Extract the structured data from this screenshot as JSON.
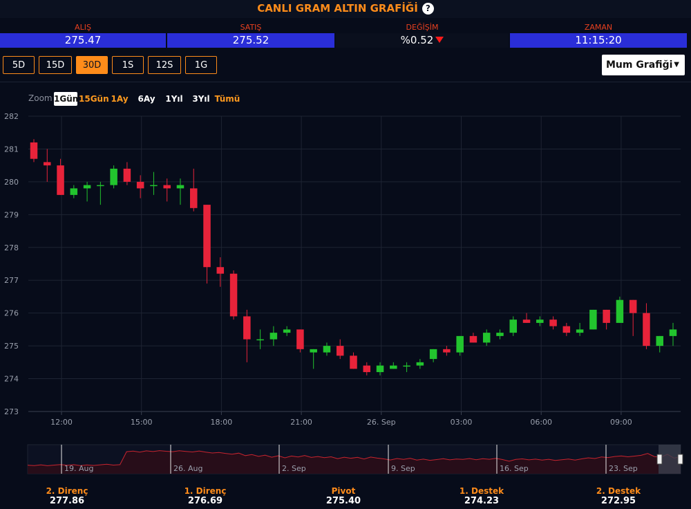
{
  "header": {
    "title": "CANLI GRAM ALTIN GRAFİĞİ",
    "help_icon": "?"
  },
  "stats": {
    "alis": {
      "label": "ALIŞ",
      "value": "275.47"
    },
    "satis": {
      "label": "SATIŞ",
      "value": "275.52"
    },
    "degisim": {
      "label": "DEĞİŞİM",
      "value": "%0.52",
      "direction": "down",
      "color": "#ff1a1a"
    },
    "zaman": {
      "label": "ZAMAN",
      "value": "11:15:20"
    }
  },
  "periods": [
    "5D",
    "15D",
    "30D",
    "1S",
    "12S",
    "1G"
  ],
  "active_period": "30D",
  "chart_type_select": {
    "value": "Mum Grafiği"
  },
  "zoom": {
    "label": "Zoom",
    "options": [
      "1Gün",
      "15Gün",
      "1Ay",
      "6Ay",
      "1Yıl",
      "3Yıl",
      "Tümü"
    ],
    "active": "1Gün"
  },
  "colors": {
    "accent": "#ff8c1a",
    "up": "#22c42e",
    "down": "#e8233a",
    "blue_bar": "#2a2ed8",
    "background": "#070c1a"
  },
  "chart_data": {
    "type": "candlestick",
    "title": "",
    "xlabel": "",
    "ylabel": "",
    "ylim": [
      273,
      282
    ],
    "y_ticks": [
      "282",
      "281",
      "280",
      "279",
      "278",
      "277",
      "276",
      "275",
      "274",
      "273"
    ],
    "x_ticks": [
      "12:00",
      "15:00",
      "18:00",
      "21:00",
      "26. Sep",
      "03:00",
      "06:00",
      "09:00"
    ],
    "grid": true,
    "candles": [
      {
        "o": 281.2,
        "h": 281.3,
        "l": 280.6,
        "c": 280.7
      },
      {
        "o": 280.6,
        "h": 281.0,
        "l": 280.0,
        "c": 280.5
      },
      {
        "o": 280.5,
        "h": 280.7,
        "l": 279.6,
        "c": 279.6
      },
      {
        "o": 279.6,
        "h": 279.9,
        "l": 279.5,
        "c": 279.8
      },
      {
        "o": 279.8,
        "h": 280.0,
        "l": 279.4,
        "c": 279.9
      },
      {
        "o": 279.9,
        "h": 280.0,
        "l": 279.3,
        "c": 279.9
      },
      {
        "o": 279.9,
        "h": 280.5,
        "l": 279.8,
        "c": 280.4
      },
      {
        "o": 280.4,
        "h": 280.6,
        "l": 279.9,
        "c": 280.0
      },
      {
        "o": 280.0,
        "h": 280.2,
        "l": 279.5,
        "c": 279.8
      },
      {
        "o": 279.9,
        "h": 280.3,
        "l": 279.6,
        "c": 279.9
      },
      {
        "o": 279.9,
        "h": 280.1,
        "l": 279.4,
        "c": 279.8
      },
      {
        "o": 279.8,
        "h": 280.1,
        "l": 279.3,
        "c": 279.9
      },
      {
        "o": 279.8,
        "h": 280.4,
        "l": 279.1,
        "c": 279.2
      },
      {
        "o": 279.3,
        "h": 279.3,
        "l": 276.9,
        "c": 277.4
      },
      {
        "o": 277.4,
        "h": 277.7,
        "l": 276.8,
        "c": 277.2
      },
      {
        "o": 277.2,
        "h": 277.3,
        "l": 275.8,
        "c": 275.9
      },
      {
        "o": 275.9,
        "h": 276.1,
        "l": 274.5,
        "c": 275.2
      },
      {
        "o": 275.2,
        "h": 275.5,
        "l": 274.9,
        "c": 275.2
      },
      {
        "o": 275.2,
        "h": 275.6,
        "l": 275.0,
        "c": 275.4
      },
      {
        "o": 275.4,
        "h": 275.6,
        "l": 275.3,
        "c": 275.5
      },
      {
        "o": 275.5,
        "h": 275.5,
        "l": 274.8,
        "c": 274.9
      },
      {
        "o": 274.8,
        "h": 274.9,
        "l": 274.3,
        "c": 274.9
      },
      {
        "o": 274.8,
        "h": 275.1,
        "l": 274.7,
        "c": 275.0
      },
      {
        "o": 275.0,
        "h": 275.2,
        "l": 274.6,
        "c": 274.7
      },
      {
        "o": 274.7,
        "h": 274.8,
        "l": 274.3,
        "c": 274.3
      },
      {
        "o": 274.4,
        "h": 274.5,
        "l": 274.1,
        "c": 274.2
      },
      {
        "o": 274.2,
        "h": 274.5,
        "l": 274.1,
        "c": 274.4
      },
      {
        "o": 274.3,
        "h": 274.5,
        "l": 274.3,
        "c": 274.4
      },
      {
        "o": 274.4,
        "h": 274.5,
        "l": 274.2,
        "c": 274.4
      },
      {
        "o": 274.4,
        "h": 274.6,
        "l": 274.3,
        "c": 274.5
      },
      {
        "o": 274.6,
        "h": 274.9,
        "l": 274.5,
        "c": 274.9
      },
      {
        "o": 274.9,
        "h": 275.0,
        "l": 274.7,
        "c": 274.8
      },
      {
        "o": 274.8,
        "h": 275.3,
        "l": 274.7,
        "c": 275.3
      },
      {
        "o": 275.3,
        "h": 275.4,
        "l": 275.1,
        "c": 275.1
      },
      {
        "o": 275.1,
        "h": 275.5,
        "l": 275.0,
        "c": 275.4
      },
      {
        "o": 275.3,
        "h": 275.5,
        "l": 275.2,
        "c": 275.4
      },
      {
        "o": 275.4,
        "h": 275.9,
        "l": 275.3,
        "c": 275.8
      },
      {
        "o": 275.8,
        "h": 276.0,
        "l": 275.7,
        "c": 275.7
      },
      {
        "o": 275.7,
        "h": 275.9,
        "l": 275.6,
        "c": 275.8
      },
      {
        "o": 275.8,
        "h": 275.9,
        "l": 275.5,
        "c": 275.6
      },
      {
        "o": 275.6,
        "h": 275.7,
        "l": 275.3,
        "c": 275.4
      },
      {
        "o": 275.4,
        "h": 275.7,
        "l": 275.3,
        "c": 275.5
      },
      {
        "o": 275.5,
        "h": 276.1,
        "l": 275.5,
        "c": 276.1
      },
      {
        "o": 276.1,
        "h": 276.1,
        "l": 275.5,
        "c": 275.7
      },
      {
        "o": 275.7,
        "h": 276.5,
        "l": 275.7,
        "c": 276.4
      },
      {
        "o": 276.4,
        "h": 276.4,
        "l": 275.3,
        "c": 276.0
      },
      {
        "o": 276.0,
        "h": 276.3,
        "l": 274.9,
        "c": 275.0
      },
      {
        "o": 275.0,
        "h": 275.3,
        "l": 274.8,
        "c": 275.3
      },
      {
        "o": 275.3,
        "h": 275.7,
        "l": 275.0,
        "c": 275.5
      }
    ]
  },
  "navigator": {
    "labels": [
      "19. Aug",
      "26. Aug",
      "2. Sep",
      "9. Sep",
      "16. Sep",
      "23. Sep"
    ],
    "series": [
      6.5,
      6.2,
      6.8,
      6.1,
      6.6,
      7.0,
      6.4,
      6.9,
      6.2,
      6.7,
      6.3,
      6.8,
      7.2,
      6.6,
      6.9,
      16.8,
      17.2,
      16.5,
      17.4,
      16.9,
      17.6,
      17.1,
      16.8,
      17.5,
      17.0,
      16.6,
      17.3,
      16.4,
      15.8,
      16.2,
      15.5,
      14.9,
      15.7,
      13.8,
      14.6,
      13.2,
      14.1,
      12.6,
      13.7,
      12.1,
      13.5,
      12.8,
      13.9,
      12.4,
      13.1,
      12.2,
      12.9,
      11.5,
      12.6,
      11.8,
      12.5,
      11.2,
      12.7,
      11.9,
      11.3,
      10.5,
      11.6,
      10.9,
      11.8,
      10.4,
      11.1,
      10.2,
      10.8,
      11.4,
      10.6,
      11.2,
      10.9,
      11.6,
      10.7,
      11.4,
      11.0,
      11.7,
      10.8,
      9.6,
      10.9,
      11.3,
      10.6,
      11.1,
      10.4,
      11.0,
      10.1,
      10.7,
      11.2,
      10.4,
      11.3,
      12.1,
      11.6,
      12.8,
      12.3,
      13.1,
      13.6,
      12.9,
      13.4,
      14.0,
      15.4,
      13.1,
      12.6,
      14.8,
      11.9,
      13.0
    ]
  },
  "pivots": [
    {
      "label": "2. Direnç",
      "value": "277.86"
    },
    {
      "label": "1. Direnç",
      "value": "276.69"
    },
    {
      "label": "Pivot",
      "value": "275.40"
    },
    {
      "label": "1. Destek",
      "value": "274.23"
    },
    {
      "label": "2. Destek",
      "value": "272.95"
    }
  ]
}
